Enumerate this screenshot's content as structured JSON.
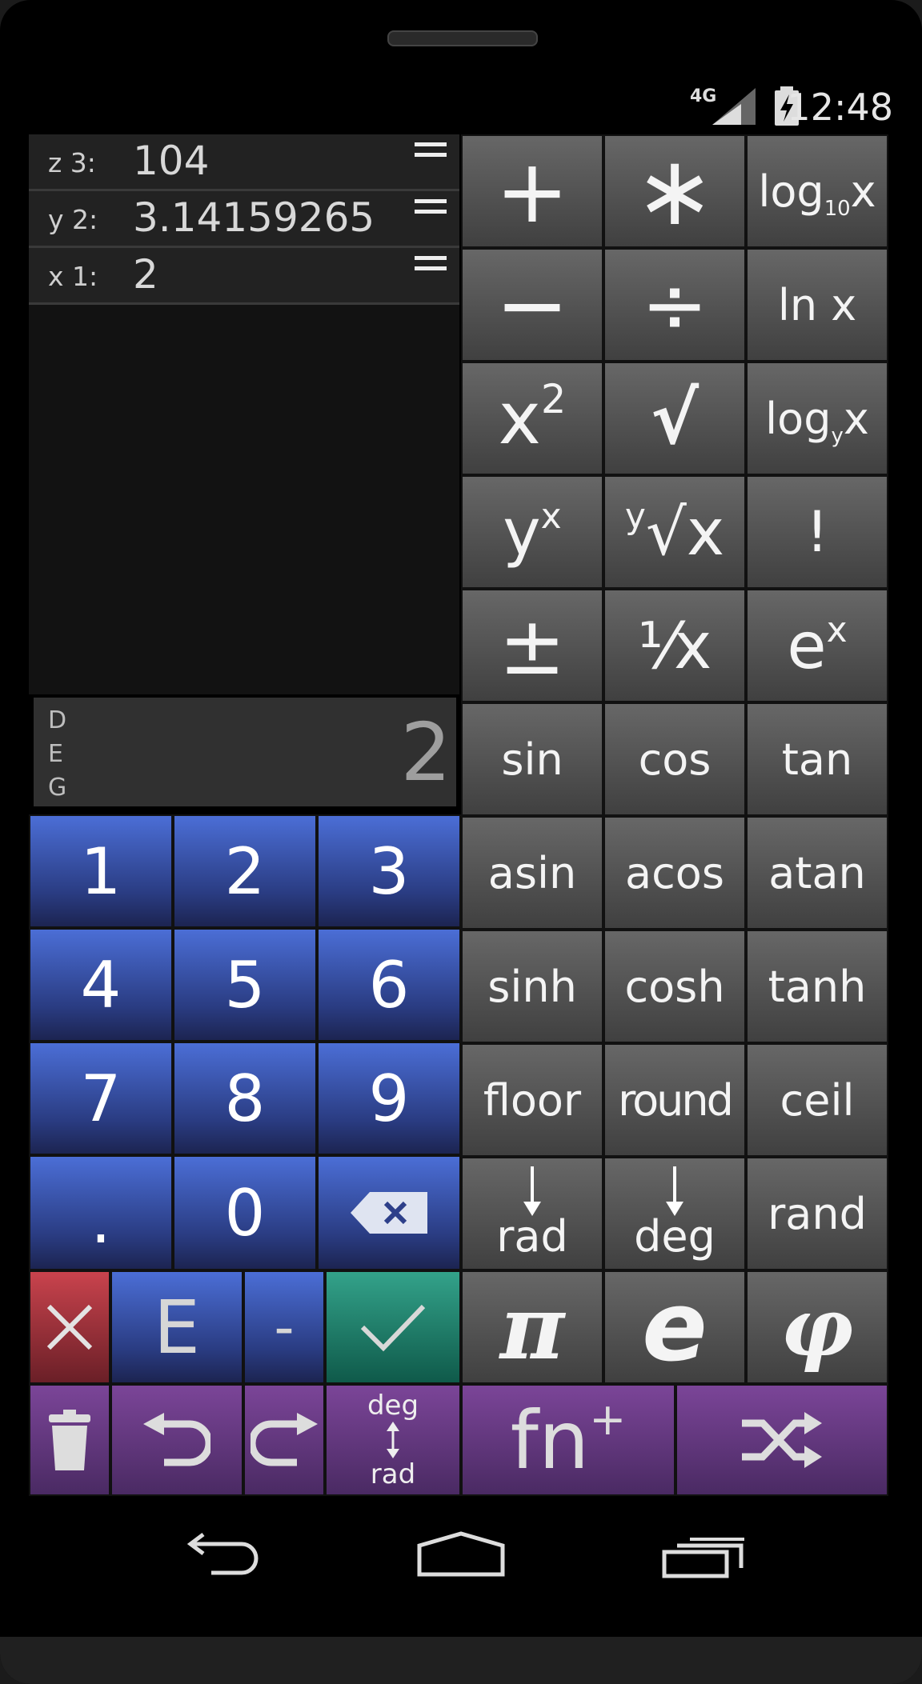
{
  "status": {
    "network": "4G",
    "time": "12:48"
  },
  "stack": [
    {
      "label": "z 3:",
      "value": "104"
    },
    {
      "label": "y 2:",
      "value": "3.14159265"
    },
    {
      "label": "x 1:",
      "value": "2"
    }
  ],
  "entry": {
    "mode": "D\nE\nG",
    "value": "2"
  },
  "numpad": {
    "k1": "1",
    "k2": "2",
    "k3": "3",
    "k4": "4",
    "k5": "5",
    "k6": "6",
    "k7": "7",
    "k8": "8",
    "k9": "9",
    "dot": ".",
    "k0": "0",
    "exp": "E",
    "minus": "-"
  },
  "functions": {
    "plus": "+",
    "times": "∗",
    "log_base": "log",
    "log10_sub": "10",
    "log_x": "x",
    "minus": "−",
    "divide": "÷",
    "ln": "ln x",
    "square_base": "x",
    "square_exp": "2",
    "sqrt": "√",
    "logy_base": "log",
    "logy_sub": "y",
    "logy_x": "x",
    "pow_base": "y",
    "pow_exp": "x",
    "root_index": "y",
    "root_body": "√x",
    "factorial": "!",
    "plusminus": "±",
    "reciprocal": "⅟x",
    "exp_base": "e",
    "exp_exp": "x",
    "sin": "sin",
    "cos": "cos",
    "tan": "tan",
    "asin": "asin",
    "acos": "acos",
    "atan": "atan",
    "sinh": "sinh",
    "cosh": "cosh",
    "tanh": "tanh",
    "floor": "floor",
    "round": "round",
    "ceil": "ceil",
    "to_rad": "rad",
    "to_deg": "deg",
    "rand": "rand",
    "pi": "π",
    "e": "e",
    "phi": "φ"
  },
  "bottom": {
    "deg": "deg",
    "rad": "rad",
    "fn": "fn",
    "fn_plus": "+"
  }
}
